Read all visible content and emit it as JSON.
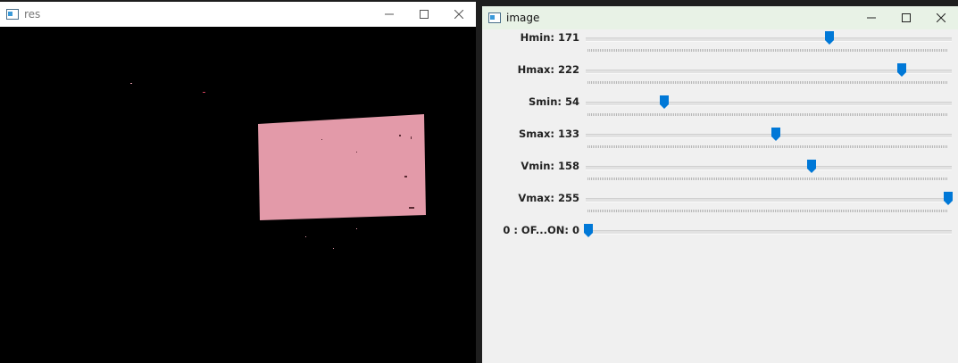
{
  "res_window": {
    "title": "res",
    "icon": "opencv-window-icon",
    "controls": [
      "minimize-icon",
      "maximize-icon",
      "close-icon"
    ]
  },
  "image_window": {
    "title": "image",
    "icon": "opencv-window-icon",
    "controls": [
      "minimize-icon",
      "maximize-icon",
      "close-icon"
    ],
    "accent_color": "#0078d7",
    "trackbars": [
      {
        "label": "Hmin: 171",
        "value": 171,
        "max": 255
      },
      {
        "label": "Hmax: 222",
        "value": 222,
        "max": 255
      },
      {
        "label": "Smin: 54",
        "value": 54,
        "max": 255
      },
      {
        "label": "Smax: 133",
        "value": 133,
        "max": 255
      },
      {
        "label": "Vmin: 158",
        "value": 158,
        "max": 255
      },
      {
        "label": "Vmax: 255",
        "value": 255,
        "max": 255
      },
      {
        "label": "0 : OF...ON: 0",
        "value": 0,
        "max": 1
      }
    ]
  },
  "mask_preview": {
    "background": "#000000",
    "region_color": "#e39aa9"
  }
}
